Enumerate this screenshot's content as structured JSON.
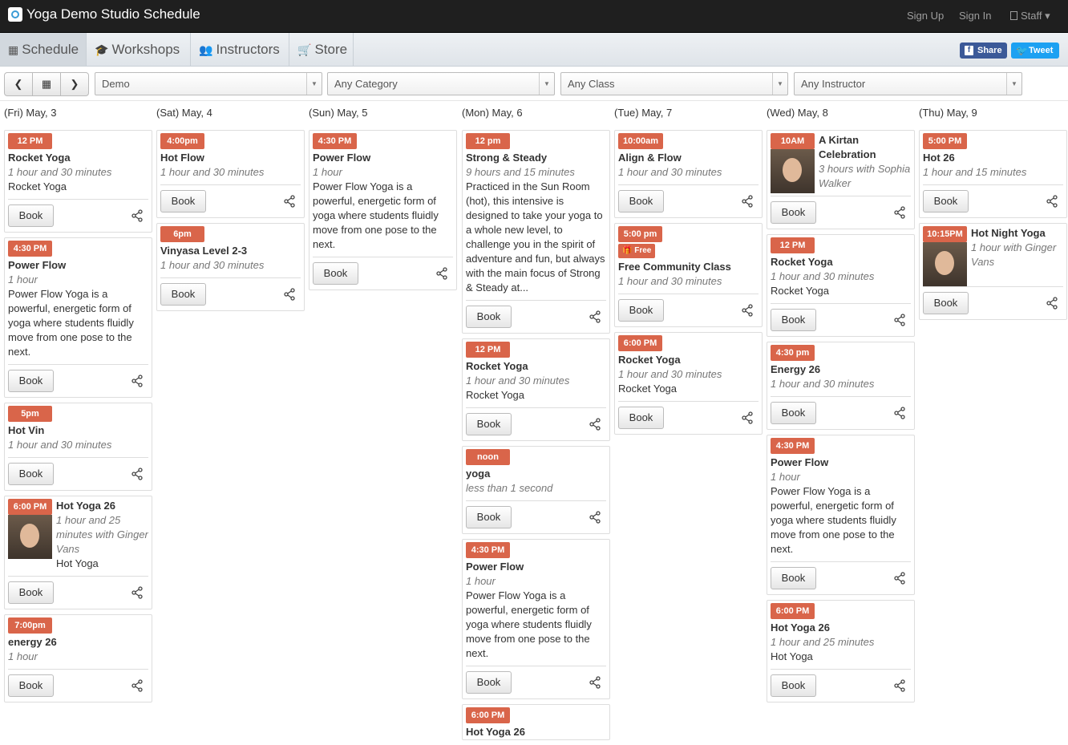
{
  "app_title": "Yoga Demo Studio Schedule",
  "top_links": {
    "signup": "Sign Up",
    "signin": "Sign In",
    "staff": "Staff"
  },
  "nav_tabs": [
    "Schedule",
    "Workshops",
    "Instructors",
    "Store"
  ],
  "social": {
    "share": "Share",
    "tweet": "Tweet"
  },
  "filters": {
    "location": "Demo",
    "category": "Any Category",
    "class": "Any Class",
    "instructor": "Any Instructor"
  },
  "book_label": "Book",
  "free_label": "Free",
  "days": [
    "(Fri) May, 3",
    "(Sat) May, 4",
    "(Sun) May, 5",
    "(Mon) May, 6",
    "(Tue) May, 7",
    "(Wed) May, 8",
    "(Thu) May, 9"
  ],
  "classes": [
    [
      {
        "time": "12 PM",
        "name": "Rocket Yoga",
        "duration": "1 hour and 30 minutes",
        "category": "Rocket Yoga"
      },
      {
        "time": "4:30 PM",
        "name": "Power Flow",
        "duration": "1 hour",
        "description": "Power Flow Yoga is a powerful, energetic form of yoga where students fluidly move from one pose to the next."
      },
      {
        "time": "5pm",
        "name": "Hot Vin",
        "duration": "1 hour and 30 minutes"
      },
      {
        "time": "6:00 PM",
        "name": "Hot Yoga 26",
        "duration": "1 hour and 25 minutes with Ginger Vans",
        "category": "Hot Yoga",
        "photo": "instructor-photo"
      },
      {
        "time": "7:00pm",
        "name": "energy 26",
        "duration": "1 hour"
      }
    ],
    [
      {
        "time": "4:00pm",
        "name": "Hot Flow",
        "duration": "1 hour and 30 minutes"
      },
      {
        "time": "6pm",
        "name": "Vinyasa Level 2-3",
        "duration": "1 hour and 30 minutes"
      }
    ],
    [
      {
        "time": "4:30 PM",
        "name": "Power Flow",
        "duration": "1 hour",
        "description": "Power Flow Yoga is a powerful, energetic form of yoga where students fluidly move from one pose to the next."
      }
    ],
    [
      {
        "time": "12 pm",
        "name": "Strong & Steady",
        "duration": "9 hours and 15 minutes",
        "description": "Practiced in the Sun Room (hot), this intensive is designed to take your yoga to a whole new level, to challenge you in the spirit of adventure and fun, but always with the main focus of Strong & Steady at..."
      },
      {
        "time": "12 PM",
        "name": "Rocket Yoga",
        "duration": "1 hour and 30 minutes",
        "category": "Rocket Yoga"
      },
      {
        "time": "noon",
        "name": "yoga",
        "duration": "less than 1 second"
      },
      {
        "time": "4:30 PM",
        "name": "Power Flow",
        "duration": "1 hour",
        "description": "Power Flow Yoga is a powerful, energetic form of yoga where students fluidly move from one pose to the next."
      },
      {
        "time": "6:00 PM",
        "name": "Hot Yoga 26"
      }
    ],
    [
      {
        "time": "10:00am",
        "name": "Align & Flow",
        "duration": "1 hour and 30 minutes"
      },
      {
        "time": "5:00 pm",
        "free": true,
        "name": "Free Community Class",
        "duration": "1 hour and 30 minutes"
      },
      {
        "time": "6:00 PM",
        "name": "Rocket Yoga",
        "duration": "1 hour and 30 minutes",
        "category": "Rocket Yoga"
      }
    ],
    [
      {
        "time": "10AM",
        "name": "A Kirtan Celebration",
        "duration": "3 hours with Sophia Walker",
        "photo": "instructor-photo"
      },
      {
        "time": "12 PM",
        "name": "Rocket Yoga",
        "duration": "1 hour and 30 minutes",
        "category": "Rocket Yoga"
      },
      {
        "time": "4:30 pm",
        "name": "Energy 26",
        "duration": "1 hour and 30 minutes"
      },
      {
        "time": "4:30 PM",
        "name": "Power Flow",
        "duration": "1 hour",
        "description": "Power Flow Yoga is a powerful, energetic form of yoga where students fluidly move from one pose to the next."
      },
      {
        "time": "6:00 PM",
        "name": "Hot Yoga 26",
        "duration": "1 hour and 25 minutes",
        "category": "Hot Yoga"
      }
    ],
    [
      {
        "time": "5:00 PM",
        "name": "Hot 26",
        "duration": "1 hour and 15 minutes"
      },
      {
        "time": "10:15PM",
        "name": "Hot Night Yoga",
        "duration": "1 hour with Ginger Vans",
        "photo": "instructor-photo"
      }
    ]
  ],
  "colors": {
    "badge": "#d9654a",
    "topbar": "#1f1f1f",
    "facebook": "#3b5998",
    "twitter": "#1da1f2"
  }
}
